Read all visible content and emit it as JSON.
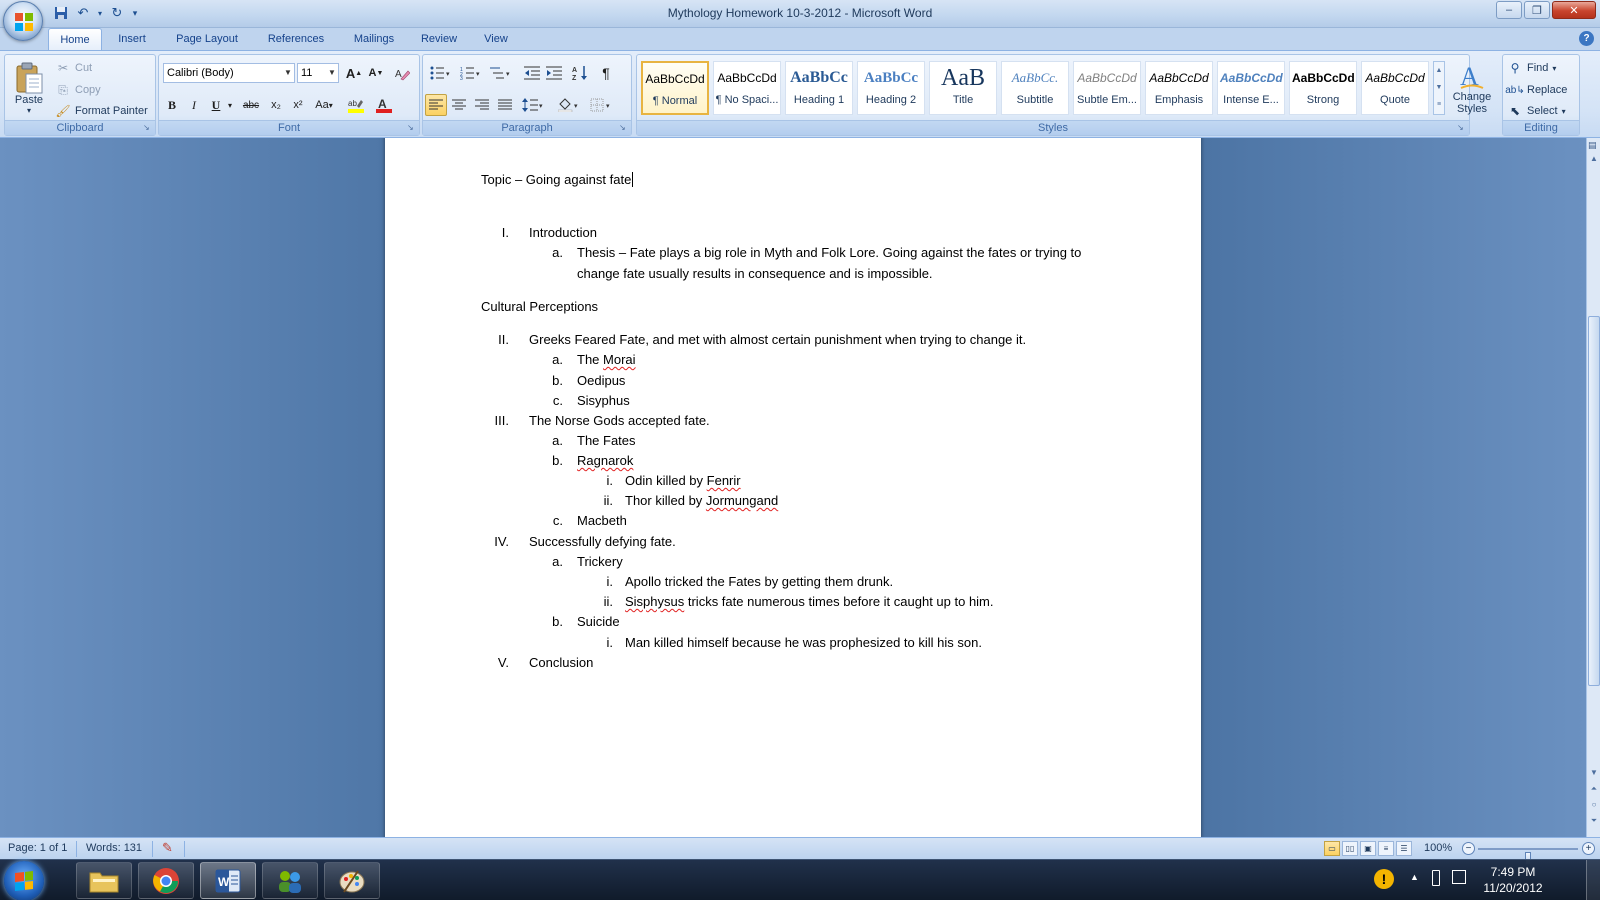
{
  "window": {
    "title": "Mythology Homework 10-3-2012 - Microsoft Word",
    "minimize": "–",
    "maximize": "❐",
    "close": "✕"
  },
  "tabs": [
    "Home",
    "Insert",
    "Page Layout",
    "References",
    "Mailings",
    "Review",
    "View"
  ],
  "clipboard": {
    "paste": "Paste",
    "cut": "Cut",
    "copy": "Copy",
    "format_painter": "Format Painter",
    "group_label": "Clipboard"
  },
  "font": {
    "name": "Calibri (Body)",
    "size": "11",
    "group_label": "Font",
    "bold": "B",
    "italic": "I",
    "underline": "U",
    "strike": "abc",
    "subscript": "x₂",
    "superscript": "x²",
    "change_case": "Aa",
    "grow": "A",
    "shrink": "A"
  },
  "paragraph": {
    "group_label": "Paragraph"
  },
  "styles": {
    "group_label": "Styles",
    "items": [
      {
        "sample": "AaBbCcDd",
        "name": "¶ Normal"
      },
      {
        "sample": "AaBbCcDd",
        "name": "¶ No Spaci..."
      },
      {
        "sample": "AaBbCc",
        "name": "Heading 1"
      },
      {
        "sample": "AaBbCc",
        "name": "Heading 2"
      },
      {
        "sample": "AaB",
        "name": "Title"
      },
      {
        "sample": "AaBbCc.",
        "name": "Subtitle"
      },
      {
        "sample": "AaBbCcDd",
        "name": "Subtle Em..."
      },
      {
        "sample": "AaBbCcDd",
        "name": "Emphasis"
      },
      {
        "sample": "AaBbCcDd",
        "name": "Intense E..."
      },
      {
        "sample": "AaBbCcDd",
        "name": "Strong"
      },
      {
        "sample": "AaBbCcDd",
        "name": "Quote"
      }
    ],
    "change_styles": "Change Styles"
  },
  "editing": {
    "group_label": "Editing",
    "find": "Find",
    "replace": "Replace",
    "select": "Select"
  },
  "document": {
    "topic": "Topic – Going against fate",
    "outline": [
      {
        "num": "I.",
        "text": "Introduction"
      },
      {
        "num": "a.",
        "text": "Thesis – Fate plays a big role in Myth and Folk Lore. Going against the fates or trying to"
      },
      {
        "num": "",
        "text": "change fate usually results in consequence and is impossible."
      },
      {
        "num": "",
        "text": "Cultural Perceptions"
      },
      {
        "num": "II.",
        "text": "Greeks Feared Fate, and met with almost certain punishment when trying to change it."
      },
      {
        "num": "a.",
        "text_pre": "The ",
        "text_err": "Morai"
      },
      {
        "num": "b.",
        "text": "Oedipus"
      },
      {
        "num": "c.",
        "text": "Sisyphus"
      },
      {
        "num": "III.",
        "text": "The Norse Gods accepted fate."
      },
      {
        "num": "a.",
        "text": "The Fates"
      },
      {
        "num": "b.",
        "text_err": "Ragnarok"
      },
      {
        "num": "i.",
        "text_pre": "Odin killed by ",
        "text_err": "Fenrir"
      },
      {
        "num": "ii.",
        "text_pre": "Thor killed by ",
        "text_err": "Jormungand"
      },
      {
        "num": "c.",
        "text": "Macbeth"
      },
      {
        "num": "IV.",
        "text": "Successfully defying fate."
      },
      {
        "num": "a.",
        "text": "Trickery"
      },
      {
        "num": "i.",
        "text": "Apollo tricked the Fates by getting them drunk."
      },
      {
        "num": "ii.",
        "text_err": "Sisphysus",
        "text_post": " tricks fate numerous times before it caught up to him."
      },
      {
        "num": "b.",
        "text": "Suicide"
      },
      {
        "num": "i.",
        "text": "Man killed himself because he was prophesized to kill his son."
      },
      {
        "num": "V.",
        "text": "Conclusion"
      }
    ]
  },
  "status": {
    "page": "Page: 1 of 1",
    "words": "Words: 131",
    "zoom": "100%",
    "zoom_level_percent": 100
  },
  "taskbar": {
    "time": "7:49 PM",
    "date": "11/20/2012"
  },
  "colors": {
    "ribbon_accent": "#15428b",
    "spell_error": "#e02020",
    "selected_style_border": "#e8b441"
  }
}
